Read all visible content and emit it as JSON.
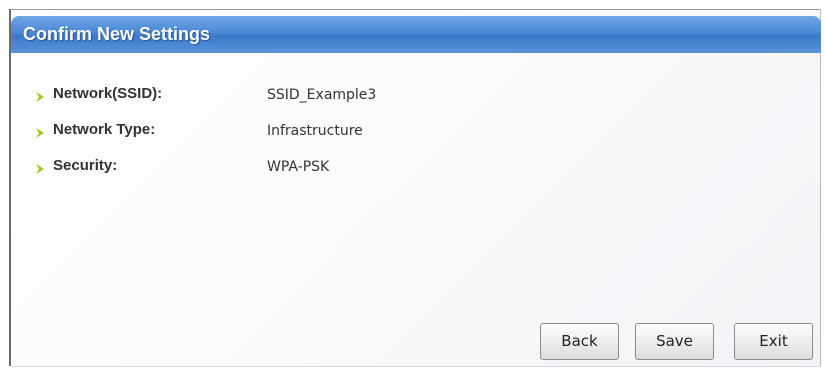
{
  "window": {
    "title": "Confirm New Settings"
  },
  "settings": [
    {
      "label": "Network(SSID):",
      "value": "SSID_Example3"
    },
    {
      "label": "Network Type:",
      "value": "Infrastructure"
    },
    {
      "label": "Security:",
      "value": "WPA-PSK"
    }
  ],
  "buttons": {
    "back_label": "Back",
    "save_label": "Save",
    "exit_label": "Exit"
  },
  "colors": {
    "title_bar": "#4a88d6",
    "bullet": "#a8c414",
    "text": "#333333"
  },
  "icons": {
    "bullet": "chevron-right-icon"
  }
}
